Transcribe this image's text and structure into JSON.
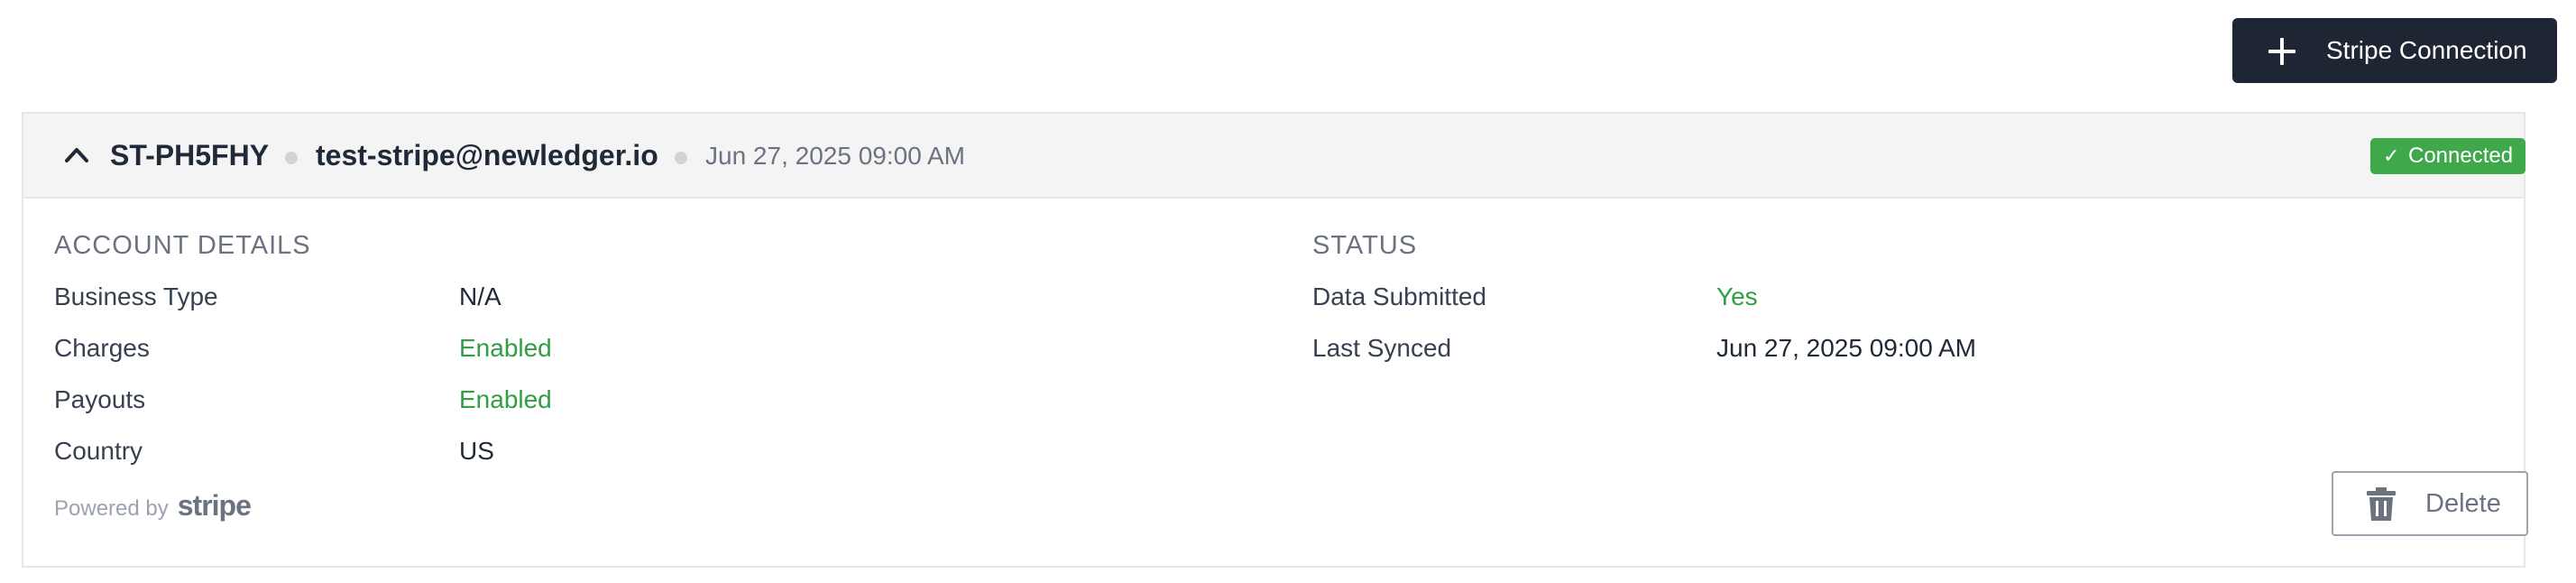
{
  "toolbar": {
    "add_label": "Stripe Connection",
    "add_icon": "plus-icon"
  },
  "connection": {
    "account_id": "ST-PH5FHY",
    "email": "test-stripe@newledger.io",
    "created_at": "Jun 27, 2025 09:00 AM",
    "status_badge": "Connected",
    "status_color": "#3ea84b",
    "expanded": true
  },
  "account_details": {
    "title": "ACCOUNT DETAILS",
    "rows": [
      {
        "label": "Business Type",
        "value": "N/A"
      },
      {
        "label": "Charges",
        "value": "Enabled"
      },
      {
        "label": "Payouts",
        "value": "Enabled"
      },
      {
        "label": "Country",
        "value": "US"
      }
    ]
  },
  "status": {
    "title": "STATUS",
    "rows": [
      {
        "label": "Data Submitted",
        "value": "Yes"
      },
      {
        "label": "Last Synced",
        "value": "Jun 27, 2025 09:00 AM"
      }
    ]
  },
  "footer": {
    "powered_by": "Powered by",
    "brand": "stripe",
    "delete_label": "Delete",
    "delete_icon": "trash-icon"
  },
  "colors": {
    "primary_button": "#1e2533",
    "success_text": "#2f9e44"
  }
}
